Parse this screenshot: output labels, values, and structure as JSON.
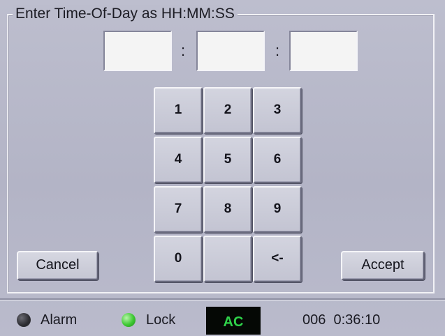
{
  "panel": {
    "title": "Enter Time-Of-Day as HH:MM:SS",
    "separator": ":"
  },
  "time_fields": {
    "hours": "",
    "minutes": "",
    "seconds": ""
  },
  "keypad": {
    "k1": "1",
    "k2": "2",
    "k3": "3",
    "k4": "4",
    "k5": "5",
    "k6": "6",
    "k7": "7",
    "k8": "8",
    "k9": "9",
    "k0": "0",
    "blank": "",
    "backspace": "<-"
  },
  "buttons": {
    "cancel": "Cancel",
    "accept": "Accept"
  },
  "status": {
    "alarm_label": "Alarm",
    "alarm_led_color": "#2b2b30",
    "lock_label": "Lock",
    "lock_led_color": "#3dc832",
    "mode": "AC",
    "mode_color": "#2fd24a",
    "counter": "006",
    "clock": "0:36:10"
  }
}
